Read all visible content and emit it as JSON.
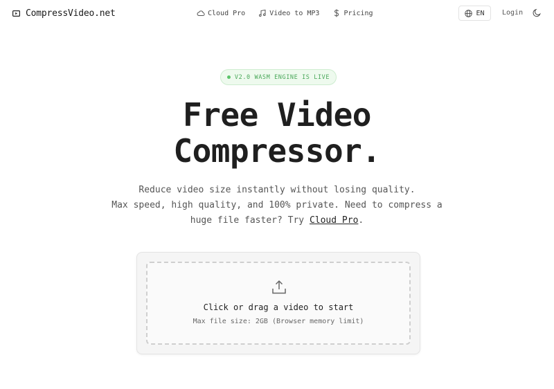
{
  "header": {
    "brand": {
      "name": "CompressVideo.net",
      "icon": "play-square-icon"
    },
    "nav": [
      {
        "label": "Cloud Pro",
        "icon": "cloud-icon"
      },
      {
        "label": "Video to MP3",
        "icon": "music-note-icon"
      },
      {
        "label": "Pricing",
        "icon": "dollar-icon"
      }
    ],
    "language": {
      "label": "EN",
      "icon": "globe-icon"
    },
    "login_label": "Login",
    "theme_icon": "moon-icon"
  },
  "hero": {
    "badge": "V2.0 WASM ENGINE IS LIVE",
    "title_line1": "Free Video",
    "title_line2": "Compressor.",
    "subtitle_line1": "Reduce video size instantly without losing quality.",
    "subtitle_line2": "Max speed, high quality, and 100% private. Need to compress a",
    "subtitle_line3_prefix": "huge file faster? Try",
    "subtitle_link": "Cloud Pro",
    "subtitle_line3_suffix": "."
  },
  "upload": {
    "icon": "upload-icon",
    "title": "Click or drag a video to start",
    "hint": "Max file size: 2GB (Browser memory limit)"
  },
  "colors": {
    "badge_bg": "#eefaee",
    "badge_text": "#4aa85a",
    "text_dark": "#1f1f1f"
  }
}
